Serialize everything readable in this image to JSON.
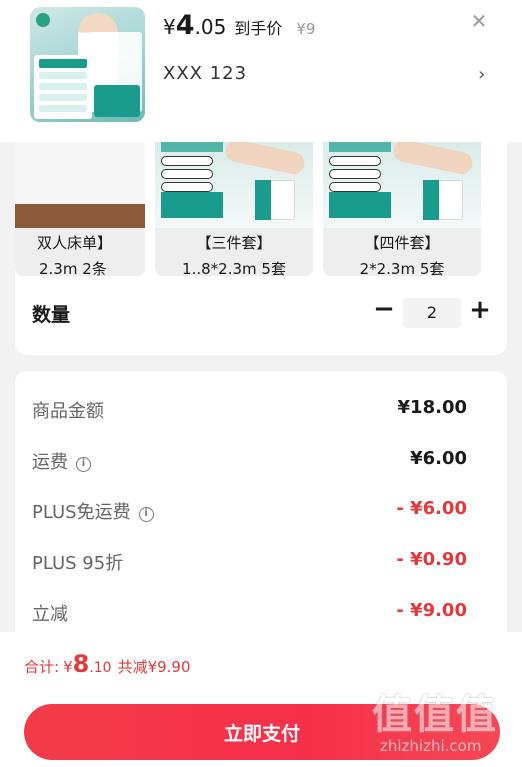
{
  "header": {
    "price_symbol": "¥",
    "price_int": "4",
    "price_dec": ".05",
    "price_tag": "到手价",
    "original_price": "¥9",
    "address": "XXX 123",
    "close_icon": "close-icon",
    "chevron_icon": "chevron-right-icon"
  },
  "options": [
    {
      "name": "双人床单】",
      "size": "2.3m 2条"
    },
    {
      "name": "【三件套】",
      "size": "1..8*2.3m 5套"
    },
    {
      "name": "【四件套】",
      "size": "2*2.3m 5套"
    }
  ],
  "quantity": {
    "label": "数量",
    "minus": "−",
    "value": "2",
    "plus": "+"
  },
  "summary": {
    "goods_amount": {
      "label": "商品金额",
      "value": "¥18.00"
    },
    "shipping": {
      "label": "运费",
      "value": "¥6.00"
    },
    "plus_free_shipping": {
      "label": "PLUS免运费",
      "value": "- ¥6.00"
    },
    "plus_discount": {
      "label": "PLUS 95折",
      "value": "- ¥0.90"
    },
    "instant_discount": {
      "label": "立减",
      "value": "- ¥9.00"
    }
  },
  "footer": {
    "total_label": "合计:",
    "total_symbol": "¥",
    "total_int": "8",
    "total_dec": ".10",
    "saved_text": "共减¥9.90",
    "pay_button": "立即支付"
  },
  "watermark": {
    "big": "值值值",
    "small": "zhizhizhi.com"
  },
  "colors": {
    "accent_red": "#e4393c",
    "pay_button": "#f23b48",
    "teal_brand": "#1a9c8c"
  }
}
